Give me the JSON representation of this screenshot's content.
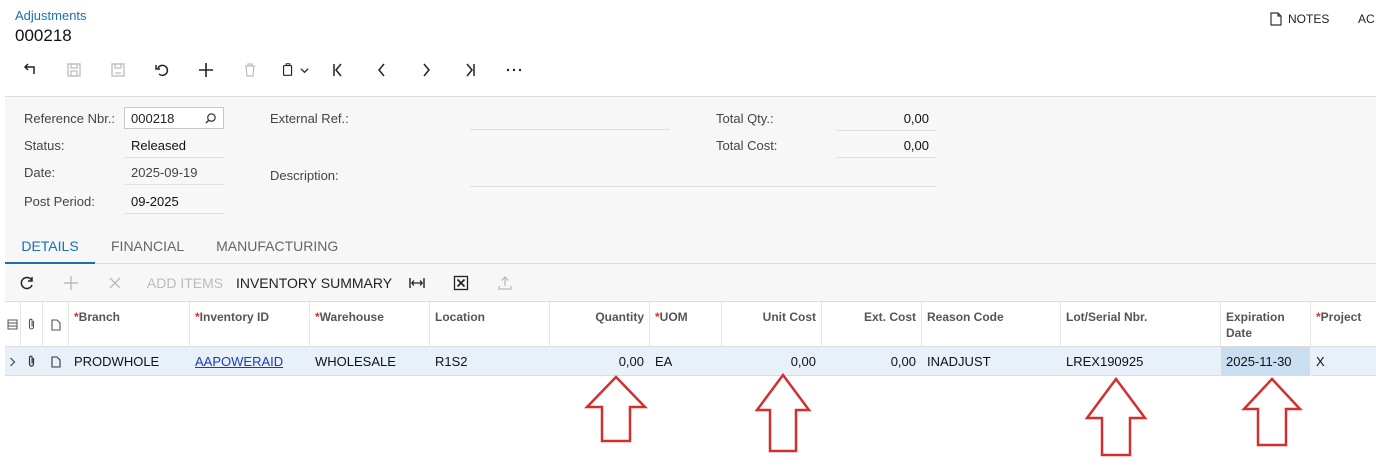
{
  "header": {
    "breadcrumb": "Adjustments",
    "title": "000218",
    "notes_label": "NOTES",
    "ac_label": "AC"
  },
  "toolbar": {
    "icons": [
      "back-arrow-icon",
      "save-close-icon",
      "save-icon",
      "undo-icon",
      "add-icon",
      "delete-icon",
      "copy-paste-icon",
      "first-record-icon",
      "previous-record-icon",
      "next-record-icon",
      "last-record-icon",
      "more-icon"
    ]
  },
  "form": {
    "reference_label": "Reference Nbr.:",
    "reference_value": "000218",
    "status_label": "Status:",
    "status_value": "Released",
    "date_label": "Date:",
    "date_value": "2025-09-19",
    "post_period_label": "Post Period:",
    "post_period_value": "09-2025",
    "external_ref_label": "External Ref.:",
    "external_ref_value": "",
    "description_label": "Description:",
    "description_value": "",
    "total_qty_label": "Total Qty.:",
    "total_qty_value": "0,00",
    "total_cost_label": "Total Cost:",
    "total_cost_value": "0,00"
  },
  "tabs": [
    {
      "label": "DETAILS",
      "active": true
    },
    {
      "label": "FINANCIAL",
      "active": false
    },
    {
      "label": "MANUFACTURING",
      "active": false
    }
  ],
  "grid_toolbar": {
    "add_items_label": "ADD ITEMS",
    "inventory_summary_label": "INVENTORY SUMMARY"
  },
  "grid": {
    "columns": {
      "branch": "Branch",
      "inventory_id": "Inventory ID",
      "warehouse": "Warehouse",
      "location": "Location",
      "quantity": "Quantity",
      "uom": "UOM",
      "unit_cost": "Unit Cost",
      "ext_cost": "Ext. Cost",
      "reason_code": "Reason Code",
      "lot_serial": "Lot/Serial Nbr.",
      "expiration_date_1": "Expiration",
      "expiration_date_2": "Date",
      "project": "Project"
    },
    "rows": [
      {
        "branch": "PRODWHOLE",
        "inventory_id": "AAPOWERAID",
        "warehouse": "WHOLESALE",
        "location": "R1S2",
        "quantity": "0,00",
        "uom": "EA",
        "unit_cost": "0,00",
        "ext_cost": "0,00",
        "reason_code": "INADJUST",
        "lot_serial": "LREX190925",
        "expiration_date": "2025-11-30",
        "project": "X"
      }
    ]
  },
  "colors": {
    "accent": "#1a6fb5",
    "required": "#d32f2f",
    "arrow": "#d32f2f",
    "row_selected": "#e8f1fa"
  }
}
